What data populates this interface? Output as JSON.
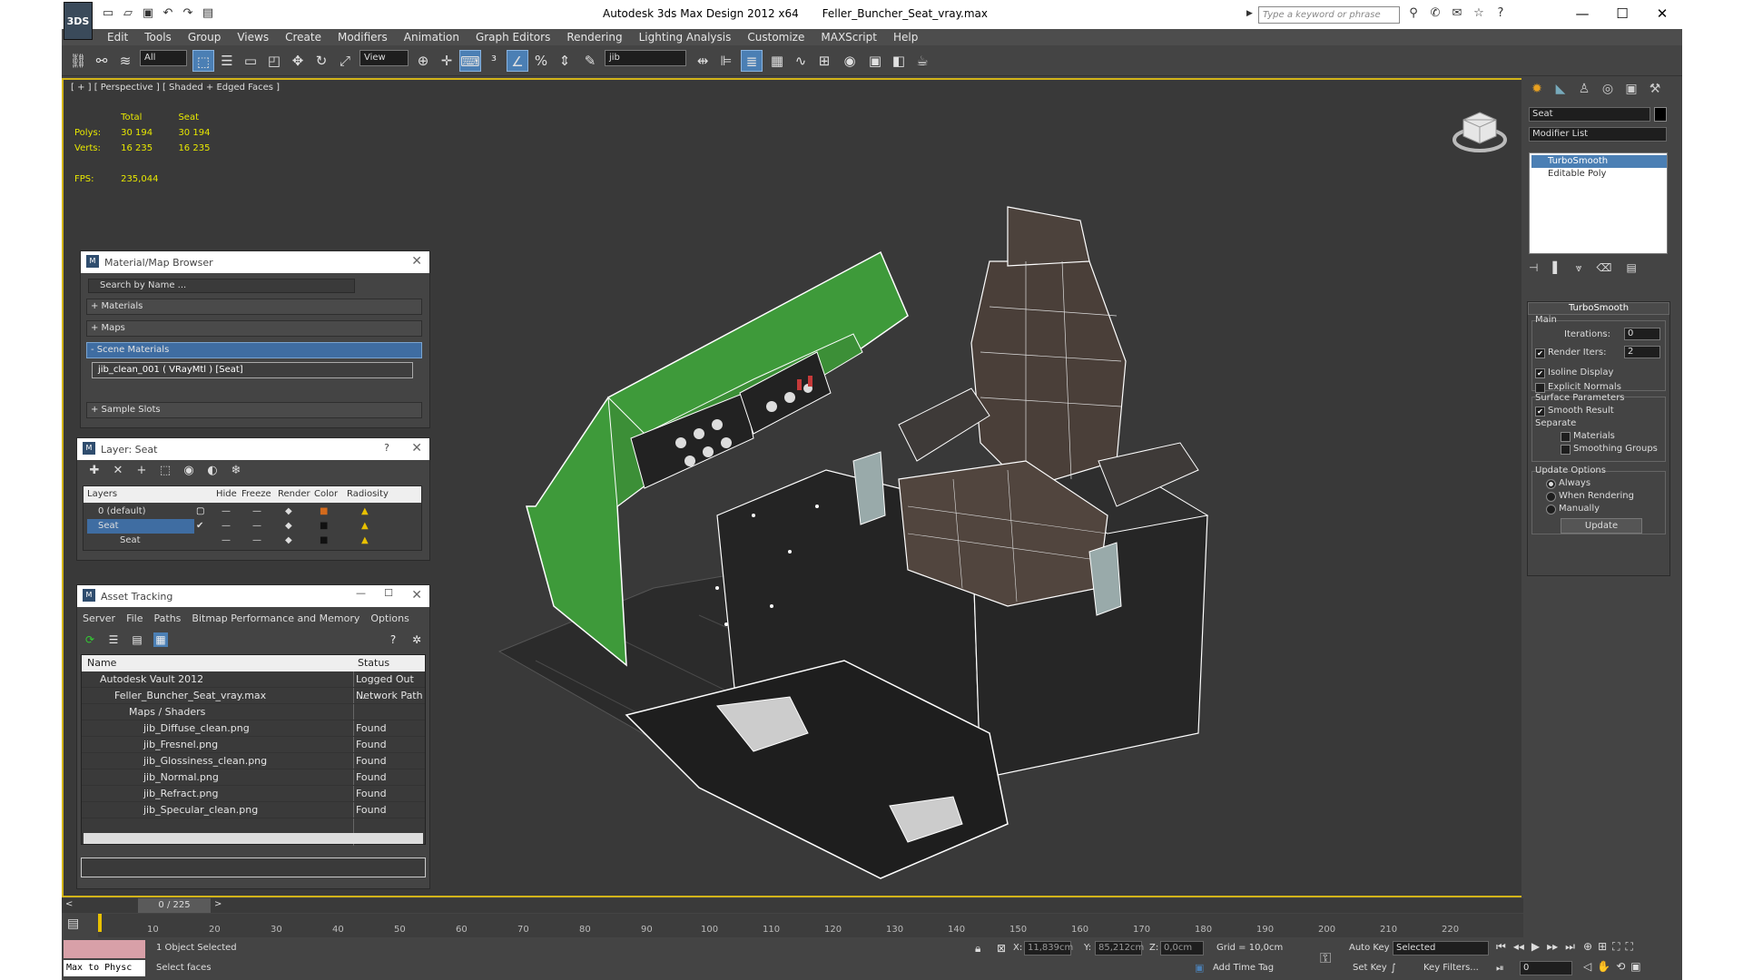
{
  "window": {
    "title": "Autodesk 3ds Max Design 2012 x64",
    "file": "Feller_Buncher_Seat_vray.max",
    "search_placeholder": "Type a keyword or phrase",
    "logo": "3DS"
  },
  "menu": [
    "Edit",
    "Tools",
    "Group",
    "Views",
    "Create",
    "Modifiers",
    "Animation",
    "Graph Editors",
    "Rendering",
    "Lighting Analysis",
    "Customize",
    "MAXScript",
    "Help"
  ],
  "toolbar": {
    "filter": "All",
    "refcoord": "View",
    "selset": "jib"
  },
  "viewport": {
    "label": "[ + ] [ Perspective ] [ Shaded + Edged Faces ]",
    "stats": {
      "h_total": "Total",
      "h_seat": "Seat",
      "polys_label": "Polys:",
      "polys_total": "30 194",
      "polys_seat": "30 194",
      "verts_label": "Verts:",
      "verts_total": "16 235",
      "verts_seat": "16 235",
      "fps_label": "FPS:",
      "fps": "235,044"
    }
  },
  "material_browser": {
    "title": "Material/Map Browser",
    "search": "Search by Name ...",
    "rows": [
      "+ Materials",
      "+ Maps",
      "- Scene Materials",
      "+ Sample Slots"
    ],
    "material": "jib_clean_001  ( VRayMtl )  [Seat]"
  },
  "layer": {
    "title": "Layer: Seat",
    "help": "?",
    "cols": [
      "Layers",
      "Hide",
      "Freeze",
      "Render",
      "Color",
      "Radiosity"
    ],
    "rows": [
      "0 (default)",
      "Seat",
      "Seat"
    ]
  },
  "asset": {
    "title": "Asset Tracking",
    "menu": [
      "Server",
      "File",
      "Paths",
      "Bitmap Performance and Memory",
      "Options"
    ],
    "cols": {
      "name": "Name",
      "status": "Status"
    },
    "rows": [
      {
        "name": "Autodesk Vault 2012",
        "status": "Logged Out ..."
      },
      {
        "name": "Feller_Buncher_Seat_vray.max",
        "status": "Network Path"
      },
      {
        "name": "Maps / Shaders",
        "status": ""
      },
      {
        "name": "jib_Diffuse_clean.png",
        "status": "Found"
      },
      {
        "name": "jib_Fresnel.png",
        "status": "Found"
      },
      {
        "name": "jib_Glossiness_clean.png",
        "status": "Found"
      },
      {
        "name": "jib_Normal.png",
        "status": "Found"
      },
      {
        "name": "jib_Refract.png",
        "status": "Found"
      },
      {
        "name": "jib_Specular_clean.png",
        "status": "Found"
      }
    ]
  },
  "command": {
    "object_name": "Seat",
    "modifier_list": "Modifier List",
    "stack": [
      "TurboSmooth",
      "Editable Poly"
    ],
    "turbosmooth": {
      "title": "TurboSmooth",
      "main": "Main",
      "iterations_label": "Iterations:",
      "iterations": "0",
      "render_iters_label": "Render Iters:",
      "render_iters": "2",
      "isoline": "Isoline Display",
      "explicit": "Explicit Normals",
      "surface": "Surface Parameters",
      "smooth_result": "Smooth Result",
      "separate": "Separate",
      "materials": "Materials",
      "smoothing_groups": "Smoothing Groups",
      "update_options": "Update Options",
      "always": "Always",
      "when_rendering": "When Rendering",
      "manually": "Manually",
      "update": "Update"
    }
  },
  "timeline": {
    "frame": "0 / 225",
    "ticks": [
      "10",
      "20",
      "30",
      "40",
      "50",
      "60",
      "70",
      "80",
      "90",
      "100",
      "110",
      "120",
      "130",
      "140",
      "150",
      "160",
      "170",
      "180",
      "190",
      "200",
      "210",
      "220"
    ]
  },
  "status": {
    "listener": "Max to Physc",
    "selected": "1 Object Selected",
    "prompt": "Select faces",
    "x_label": "X:",
    "x": "11,839cm",
    "y_label": "Y:",
    "y": "85,212cm",
    "z_label": "Z:",
    "z": "0,0cm",
    "grid": "Grid = 10,0cm",
    "add_time_tag": "Add Time Tag",
    "auto_key": "Auto Key",
    "set_key": "Set Key",
    "key_mode": "Selected",
    "key_filters": "Key Filters...",
    "frame_field": "0"
  }
}
